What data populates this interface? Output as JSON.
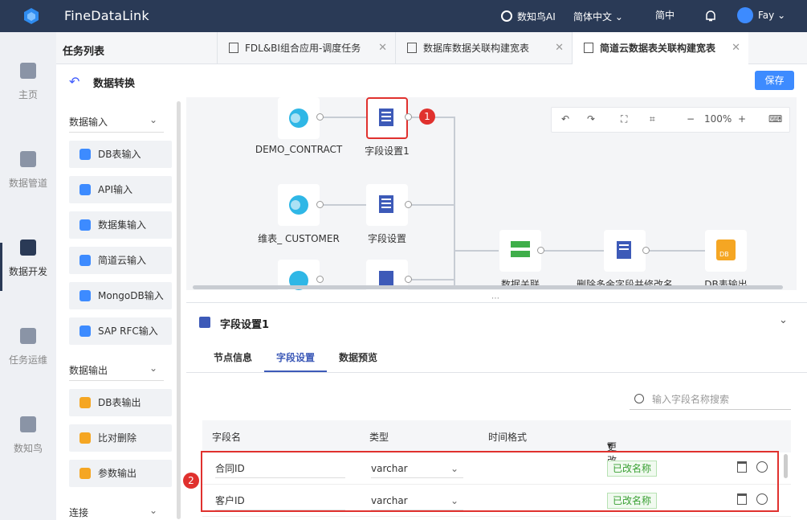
{
  "topbar": {
    "title": "FineDataLink",
    "ai_label": "数知鸟AI",
    "lang_label": "简体中文",
    "lang_short": "简中",
    "user_name": "Fay"
  },
  "leftnav": {
    "items": [
      {
        "label": "主页",
        "icon": "home-icon"
      },
      {
        "label": "数据管道",
        "icon": "pipeline-icon"
      },
      {
        "label": "数据开发",
        "icon": "dev-icon",
        "active": true
      },
      {
        "label": "任务运维",
        "icon": "ops-icon"
      },
      {
        "label": "数知鸟",
        "icon": "list-icon"
      }
    ]
  },
  "tabs": {
    "task_list": "任务列表",
    "items": [
      {
        "label": "FDL&BI组合应用-调度任务"
      },
      {
        "label": "数据库数据关联构建宽表"
      },
      {
        "label": "简道云数据表关联构建宽表",
        "active": true
      }
    ]
  },
  "subheader": {
    "title": "数据转换",
    "save_label": "保存"
  },
  "panel": {
    "input_section": "数据输入",
    "input_items": [
      "DB表输入",
      "API输入",
      "数据集输入",
      "简道云输入",
      "MongoDB输入",
      "SAP RFC输入"
    ],
    "output_section": "数据输出",
    "output_items": [
      "DB表输出",
      "比对删除",
      "参数输出"
    ],
    "connect_section": "连接"
  },
  "canvas": {
    "zoom": "100%",
    "nodes": {
      "demo_contract": "DEMO_CONTRACT",
      "field1": "字段设置1",
      "customer": "维表_ CUSTOMER",
      "field2": "字段设置",
      "join": "数据关联",
      "rename": "删除多余字段并修改名",
      "db_output": "DB表输出"
    },
    "badge1": "1",
    "badge2": "2"
  },
  "detail": {
    "title": "字段设置1",
    "tabs": [
      "节点信息",
      "字段设置",
      "数据预览"
    ],
    "search_placeholder": "输入字段名称搜索",
    "columns": [
      "字段名",
      "类型",
      "时间格式",
      "更改"
    ],
    "rows": [
      {
        "name": "合同ID",
        "type": "varchar",
        "status": "已改名称"
      },
      {
        "name": "客户ID",
        "type": "varchar",
        "status": "已改名称"
      }
    ]
  }
}
